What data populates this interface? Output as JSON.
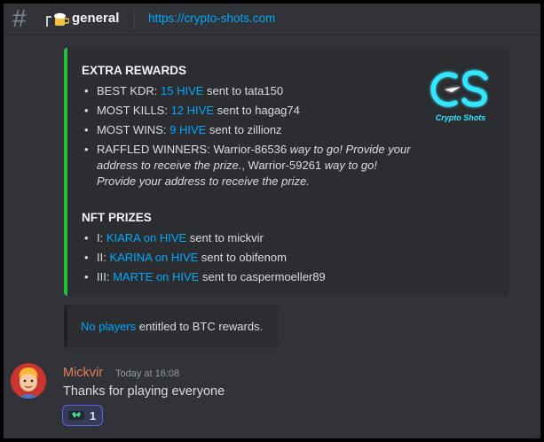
{
  "header": {
    "channel_name": "general",
    "topic_link": "https://crypto-shots.com"
  },
  "embed": {
    "logo_text": "Crypto Shots",
    "extra_title": "EXTRA REWARDS",
    "extra_items": [
      {
        "prefix": "BEST KDR: ",
        "link": "15 HIVE",
        "suffix": " sent to tata150"
      },
      {
        "prefix": "MOST KILLS: ",
        "link": "12 HIVE",
        "suffix": " sent to hagag74"
      },
      {
        "prefix": "MOST WINS: ",
        "link": "9 HIVE",
        "suffix": " sent to zillionz"
      }
    ],
    "raffle": {
      "prefix": "RAFFLED WINNERS: Warrior-86536 ",
      "italic1": "way to go! Provide your address to receive the prize.",
      "mid": ", Warrior-59261 ",
      "italic2": "way to go! Provide your address to receive the prize."
    },
    "nft_title": "NFT PRIZES",
    "nft_items": [
      {
        "prefix": "I: ",
        "link": "KIARA on HIVE",
        "suffix": " sent to mickvir"
      },
      {
        "prefix": "II: ",
        "link": "KARINA on HIVE",
        "suffix": " sent to obifenom"
      },
      {
        "prefix": "III: ",
        "link": "MARTE on HIVE",
        "suffix": " sent to caspermoeller89"
      }
    ]
  },
  "embed2": {
    "link": "No players",
    "text": " entitled to BTC rewards."
  },
  "message": {
    "author": "Mickvir",
    "timestamp": "Today at 16:08",
    "content": "Thanks for playing everyone",
    "reaction_count": "1"
  },
  "colors": {
    "accent_green": "#23c13a",
    "link": "#00a8fc",
    "author": "#e67e57",
    "reaction_border": "#5865f2"
  }
}
